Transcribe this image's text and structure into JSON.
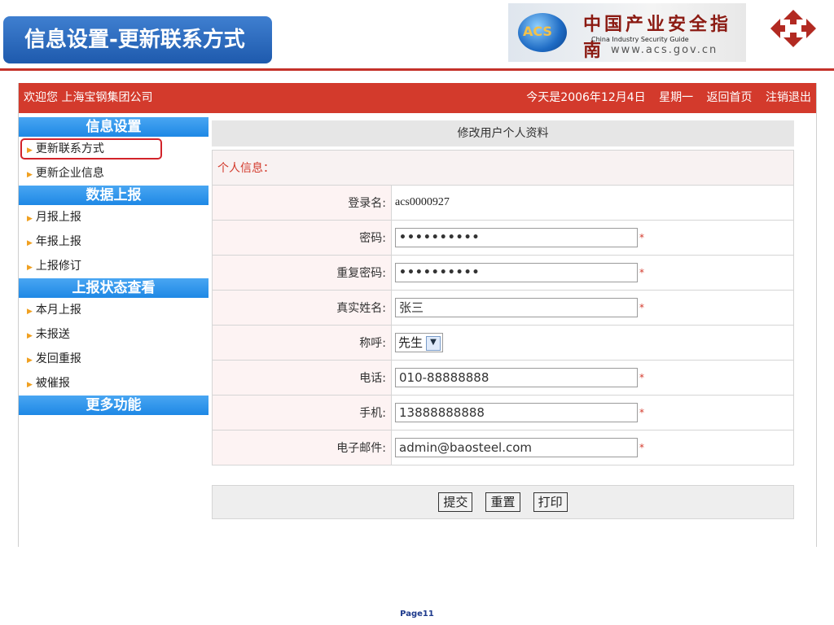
{
  "slide": {
    "title": "信息设置-更新联系方式",
    "page": "Page11"
  },
  "logo": {
    "globe": "ACS",
    "cn": "中国产业安全指南",
    "en": "China  Industry  Security  Guide",
    "url": "www.acs.gov.cn"
  },
  "topbar": {
    "welcome": "欢迎您  上海宝钢集团公司",
    "date": "今天是2006年12月4日",
    "weekday": "星期一",
    "home": "返回首页",
    "logout": "注销退出"
  },
  "sidebar": {
    "groups": [
      {
        "title": "信息设置",
        "items": [
          "更新联系方式",
          "更新企业信息"
        ]
      },
      {
        "title": "数据上报",
        "items": [
          "月报上报",
          "年报上报",
          "上报修订"
        ]
      },
      {
        "title": "上报状态查看",
        "items": [
          "本月上报",
          "未报送",
          "发回重报",
          "被催报"
        ]
      },
      {
        "title": "更多功能",
        "items": []
      }
    ],
    "active": "更新联系方式"
  },
  "form": {
    "title": "修改用户个人资料",
    "section": "个人信息：",
    "login_label": "登录名:",
    "login_value": "acs0000927",
    "password_label": "密码:",
    "password_value": "••••••••••",
    "repeat_password_label": "重复密码:",
    "repeat_password_value": "••••••••••",
    "realname_label": "真实姓名:",
    "realname_value": "张三",
    "title_label": "称呼:",
    "title_value": "先生",
    "phone_label": "电话:",
    "phone_value": "010-88888888",
    "mobile_label": "手机:",
    "mobile_value": "13888888888",
    "email_label": "电子邮件:",
    "email_value": "admin@baosteel.com",
    "required_mark": "*"
  },
  "buttons": {
    "submit": "提交",
    "reset": "重置",
    "print": "打印"
  },
  "colors": {
    "topbar": "#d33a2c",
    "sidebar_header": "#1e88e5",
    "highlight": "#d2232a"
  }
}
